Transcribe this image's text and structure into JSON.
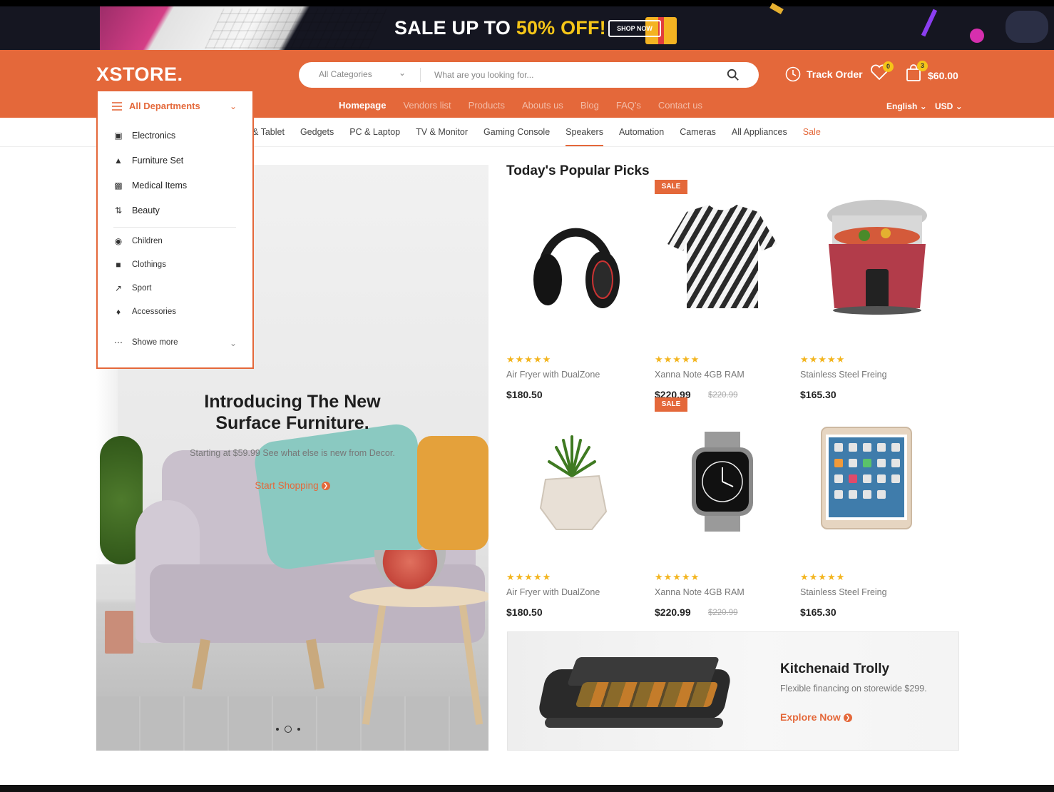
{
  "promo": {
    "text_prefix": "SALE UP TO ",
    "text_highlight": "50% OFF!",
    "button": "SHOP NOW"
  },
  "header": {
    "logo": "XSTORE.",
    "search": {
      "category": "All Categories",
      "placeholder": "What are you looking for..."
    },
    "track_order": "Track Order",
    "wishlist_count": "0",
    "cart_count": "3",
    "cart_total": "$60.00",
    "language": "English",
    "currency": "USD"
  },
  "main_nav": [
    "Homepage",
    "Vendors list",
    "Products",
    "Abouts us",
    "Blog",
    "FAQ's",
    "Contact us"
  ],
  "category_nav": [
    "& Tablet",
    "Gedgets",
    "PC & Laptop",
    "TV & Monitor",
    "Gaming Console",
    "Speakers",
    "Automation",
    "Cameras",
    "All Appliances",
    "Sale"
  ],
  "departments": {
    "title": "All Departments",
    "primary": [
      {
        "label": "Electronics",
        "icon": "laptop-icon"
      },
      {
        "label": "Furniture Set",
        "icon": "lamp-icon"
      },
      {
        "label": "Medical Items",
        "icon": "medical-kit-icon"
      },
      {
        "label": "Beauty",
        "icon": "beauty-icon"
      }
    ],
    "secondary": [
      {
        "label": "Children",
        "icon": "child-icon"
      },
      {
        "label": "Clothings",
        "icon": "shirt-icon"
      },
      {
        "label": "Sport",
        "icon": "sport-icon"
      },
      {
        "label": "Accessories",
        "icon": "accessory-icon"
      }
    ],
    "more": "Showe more"
  },
  "hero": {
    "title_line1": "Introducing The New",
    "title_line2": "Surface Furniture.",
    "subtitle": "Starting at $59.99 See what else is new from Decor.",
    "cta": "Start Shopping"
  },
  "picks": {
    "title": "Today's Popular Picks",
    "products": [
      {
        "name": "Air Fryer with DualZone",
        "price": "$180.50",
        "old_price": "",
        "sale": false,
        "rating": 5,
        "image": "headphones"
      },
      {
        "name": "Xanna Note 4GB RAM",
        "price": "$220.99",
        "old_price": "$220.99",
        "sale": true,
        "sale_label": "SALE",
        "rating": 5,
        "image": "zebra-tshirt"
      },
      {
        "name": "Stainless Steel Freing",
        "price": "$165.30",
        "old_price": "",
        "sale": false,
        "rating": 5,
        "image": "rice-cooker"
      },
      {
        "name": "Air Fryer with DualZone",
        "price": "$180.50",
        "old_price": "",
        "sale": false,
        "rating": 5,
        "image": "potted-plant"
      },
      {
        "name": "Xanna Note 4GB RAM",
        "price": "$220.99",
        "old_price": "$220.99",
        "sale": true,
        "sale_label": "SALE",
        "rating": 5,
        "image": "smartwatch"
      },
      {
        "name": "Stainless Steel Freing",
        "price": "$165.30",
        "old_price": "",
        "sale": false,
        "rating": 5,
        "image": "tablet"
      }
    ]
  },
  "kitchen_promo": {
    "title": "Kitchenaid Trolly",
    "subtitle": "Flexible financing on storewide $299.",
    "cta": "Explore Now"
  },
  "colors": {
    "accent": "#e4683a",
    "star": "#f3b51f",
    "promo_highlight": "#f5c518"
  }
}
